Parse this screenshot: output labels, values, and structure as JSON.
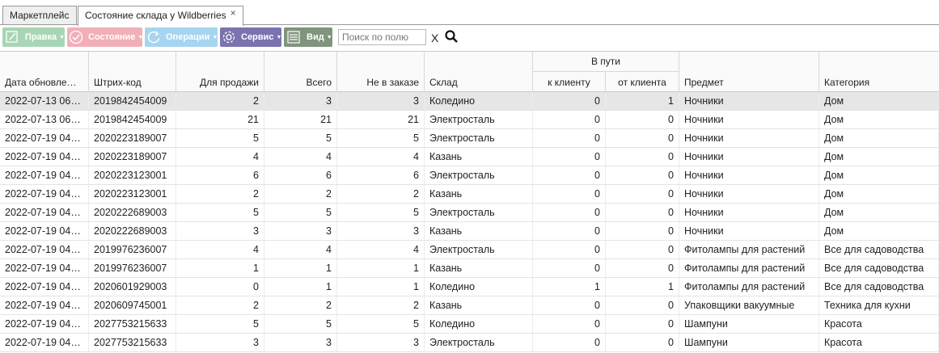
{
  "tabs": [
    {
      "label": "Маркетплейс"
    },
    {
      "label": "Состояние склада у Wildberries",
      "close": "×"
    }
  ],
  "toolbar": {
    "edit": "Правка",
    "state": "Состояние",
    "ops": "Операции",
    "service": "Сервис",
    "view": "Вид",
    "search_placeholder": "Поиск по полю",
    "clear": "X"
  },
  "colors": {
    "edit": "#a8d6b4",
    "state": "#f1b0b8",
    "ops": "#a6d5f0",
    "service": "#7b73b0",
    "view": "#7f957c",
    "selected_row": "#e6e6e6"
  },
  "table": {
    "headers": {
      "date": "Дата обновле…",
      "barcode": "Штрих-код",
      "for_sale": "Для продажи",
      "total": "Всего",
      "not_ordered": "Не в заказе",
      "warehouse": "Склад",
      "in_transit": "В пути",
      "to_client": "к клиенту",
      "from_client": "от клиента",
      "subject": "Предмет",
      "category": "Категория"
    },
    "rows": [
      [
        "2022-07-13 06…",
        "2019842454009",
        "2",
        "3",
        "3",
        "Коледино",
        "0",
        "1",
        "Ночники",
        "Дом"
      ],
      [
        "2022-07-13 06…",
        "2019842454009",
        "21",
        "21",
        "21",
        "Электросталь",
        "0",
        "0",
        "Ночники",
        "Дом"
      ],
      [
        "2022-07-19 04…",
        "2020223189007",
        "5",
        "5",
        "5",
        "Электросталь",
        "0",
        "0",
        "Ночники",
        "Дом"
      ],
      [
        "2022-07-19 04…",
        "2020223189007",
        "4",
        "4",
        "4",
        "Казань",
        "0",
        "0",
        "Ночники",
        "Дом"
      ],
      [
        "2022-07-19 04…",
        "2020223123001",
        "6",
        "6",
        "6",
        "Электросталь",
        "0",
        "0",
        "Ночники",
        "Дом"
      ],
      [
        "2022-07-19 04…",
        "2020223123001",
        "2",
        "2",
        "2",
        "Казань",
        "0",
        "0",
        "Ночники",
        "Дом"
      ],
      [
        "2022-07-19 04…",
        "2020222689003",
        "5",
        "5",
        "5",
        "Электросталь",
        "0",
        "0",
        "Ночники",
        "Дом"
      ],
      [
        "2022-07-19 04…",
        "2020222689003",
        "3",
        "3",
        "3",
        "Казань",
        "0",
        "0",
        "Ночники",
        "Дом"
      ],
      [
        "2022-07-19 04…",
        "2019976236007",
        "4",
        "4",
        "4",
        "Электросталь",
        "0",
        "0",
        "Фитолампы для растений",
        "Все для садоводства"
      ],
      [
        "2022-07-19 04…",
        "2019976236007",
        "1",
        "1",
        "1",
        "Казань",
        "0",
        "0",
        "Фитолампы для растений",
        "Все для садоводства"
      ],
      [
        "2022-07-19 04…",
        "2020601929003",
        "0",
        "1",
        "1",
        "Коледино",
        "1",
        "1",
        "Фитолампы для растений",
        "Все для садоводства"
      ],
      [
        "2022-07-19 04…",
        "2020609745001",
        "2",
        "2",
        "2",
        "Казань",
        "0",
        "0",
        "Упаковщики вакуумные",
        "Техника для кухни"
      ],
      [
        "2022-07-19 04…",
        "2027753215633",
        "5",
        "5",
        "5",
        "Коледино",
        "0",
        "0",
        "Шампуни",
        "Красота"
      ],
      [
        "2022-07-19 04…",
        "2027753215633",
        "3",
        "3",
        "3",
        "Электросталь",
        "0",
        "0",
        "Шампуни",
        "Красота"
      ]
    ]
  }
}
